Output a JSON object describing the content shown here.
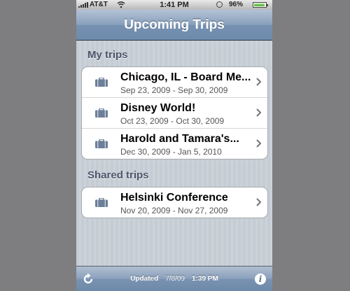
{
  "status_bar": {
    "carrier": "AT&T",
    "time": "1:41 PM",
    "battery_percent": "96%",
    "battery_level": 0.96
  },
  "nav": {
    "title": "Upcoming Trips"
  },
  "sections": [
    {
      "header": "My trips",
      "trips": [
        {
          "title": "Chicago, IL - Board Me...",
          "dates": "Sep 23, 2009 - Sep 30, 2009",
          "icon": "suitcase-icon"
        },
        {
          "title": "Disney World!",
          "dates": "Oct 23, 2009 - Oct 30, 2009",
          "icon": "suitcase-icon"
        },
        {
          "title": "Harold and Tamara's...",
          "dates": "Dec 30, 2009 - Jan 5, 2010",
          "icon": "suitcase-icon"
        }
      ]
    },
    {
      "header": "Shared trips",
      "trips": [
        {
          "title": "Helsinki Conference",
          "dates": "Nov 20, 2009 - Nov 27, 2009",
          "icon": "suitcase-icon"
        }
      ]
    }
  ],
  "toolbar": {
    "updated_label": "Updated",
    "updated_date": "7/8/09",
    "updated_time": "1:39 PM"
  },
  "colors": {
    "nav_bar": "#7590b1",
    "background_stripe": "#c5ccd4",
    "section_header": "#4c566c",
    "icon": "#6d7f98"
  }
}
